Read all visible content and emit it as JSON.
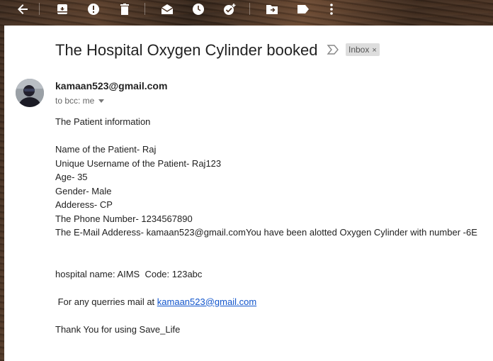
{
  "toolbar": {
    "icons": [
      "back-arrow-icon",
      "archive-icon",
      "report-spam-icon",
      "delete-icon",
      "mark-unread-icon",
      "snooze-icon",
      "add-task-icon",
      "move-to-icon",
      "label-icon",
      "more-vert-icon"
    ]
  },
  "email": {
    "subject": "The Hospital Oxygen Cylinder booked",
    "label_chip": "Inbox",
    "label_close": "×",
    "sender": "kamaan523@gmail.com",
    "recipient_line": "to bcc: me",
    "body": {
      "intro": "The Patient information",
      "name": "Name of the Patient- Raj",
      "username": "Unique Username of the Patient- Raj123",
      "age": "Age- 35",
      "gender": "Gender- Male",
      "address": "Adderess- CP",
      "phone": "The Phone Number- 1234567890",
      "email_line": "The E-Mail Adderess- kamaan523@gmail.comYou have been alotted Oxygen Cylinder with number -6E",
      "hospital": "hospital name: AIMS  Code: 123abc",
      "queries_prefix": " For any querries mail at ",
      "queries_link": "kamaan523@gmail.com",
      "thanks": "Thank You for using Save_Life"
    }
  }
}
